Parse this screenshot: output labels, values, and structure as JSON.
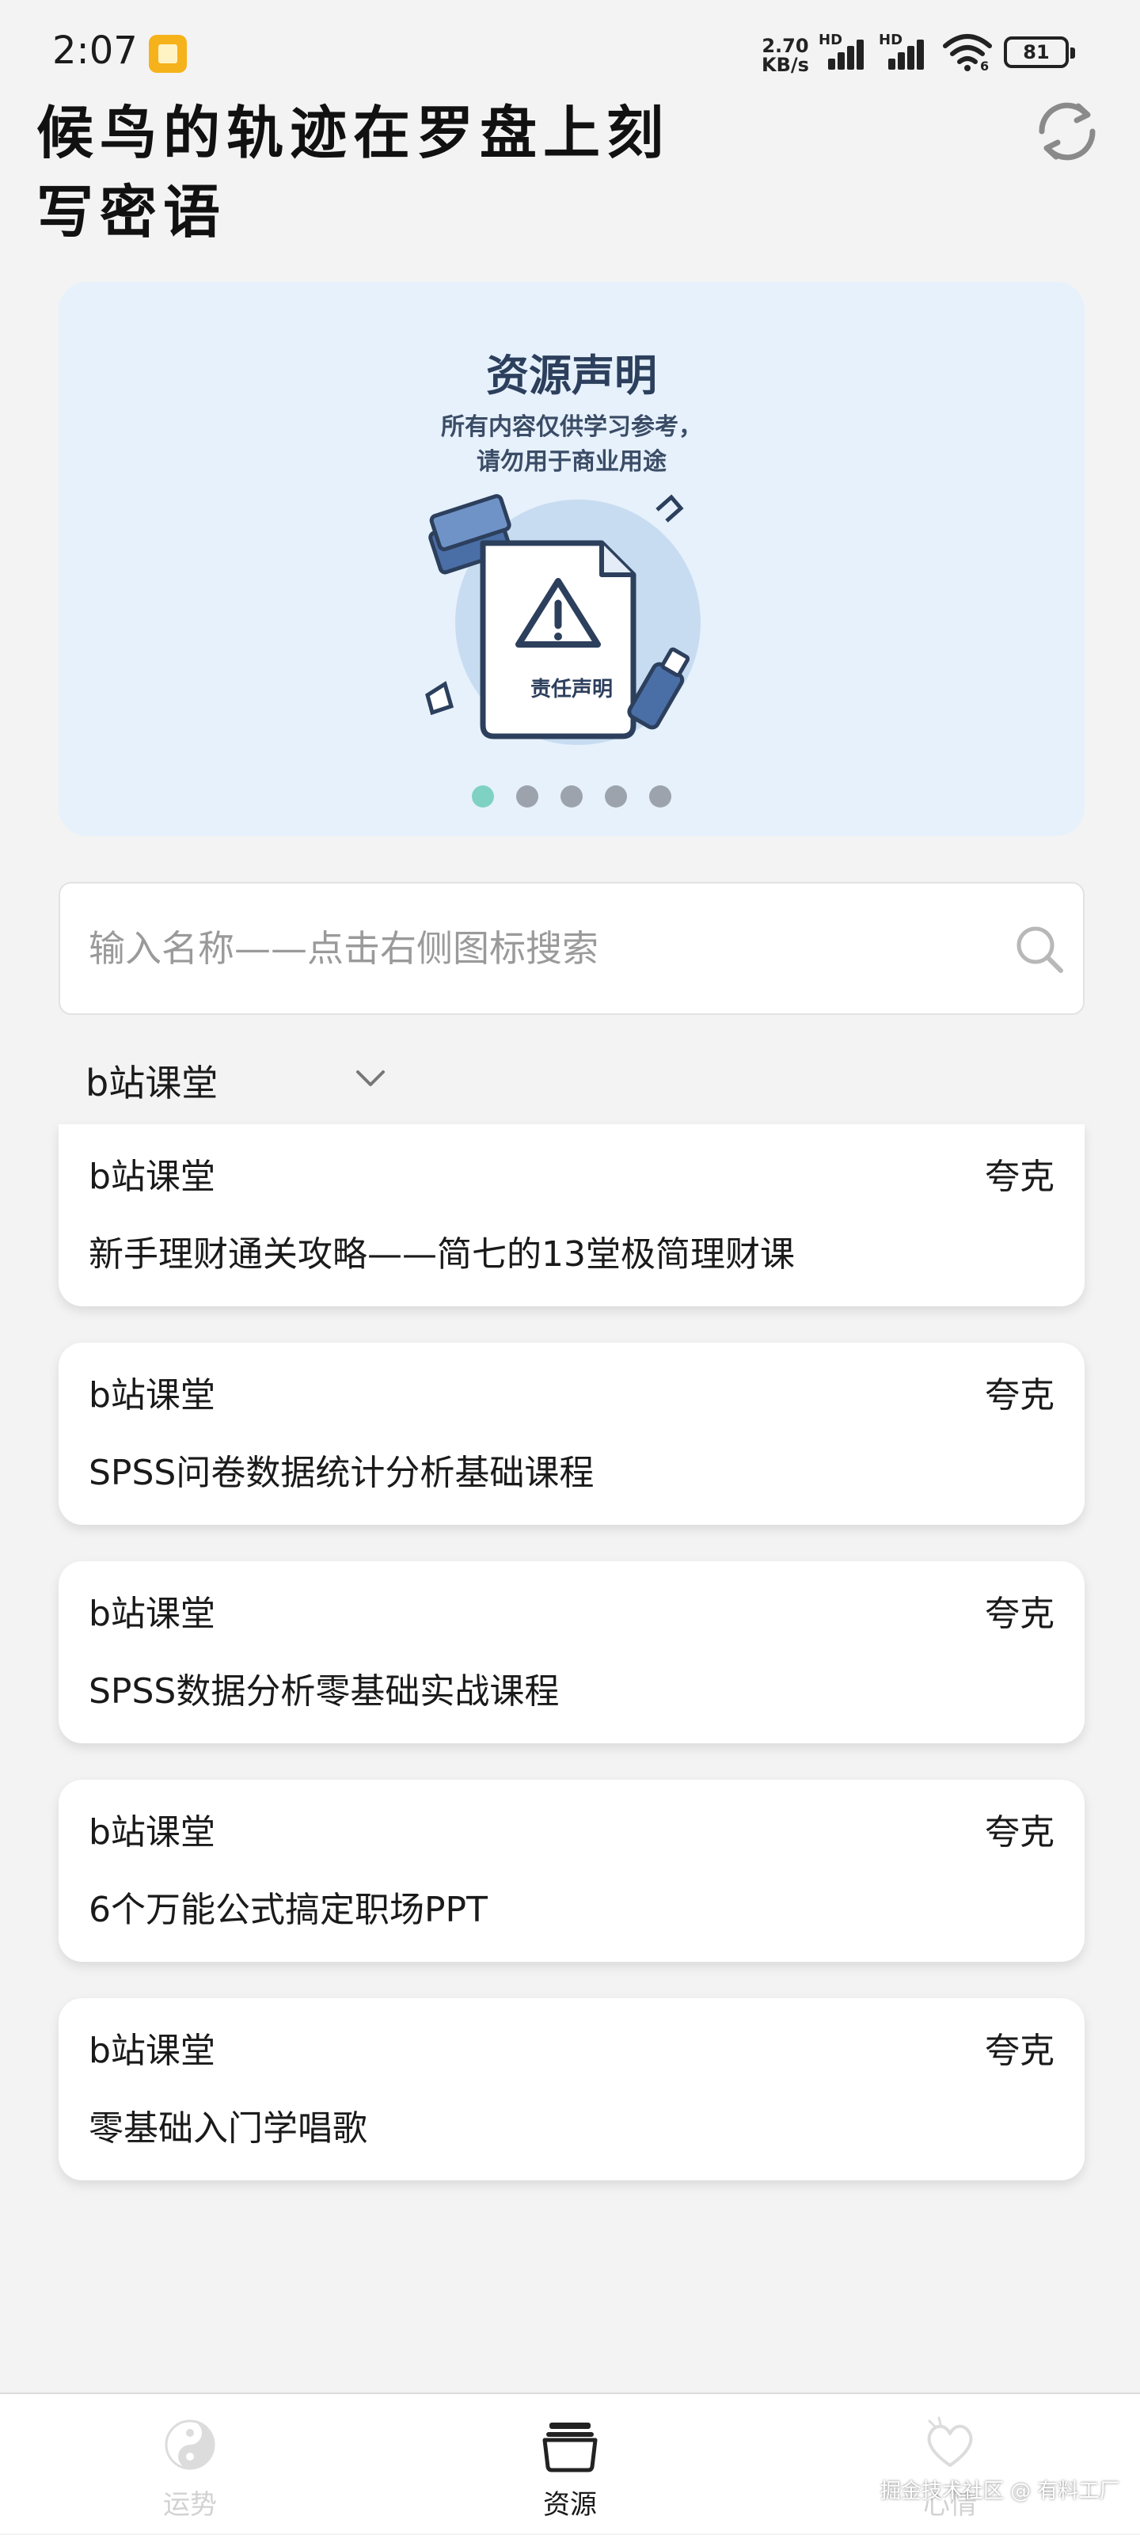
{
  "status_bar": {
    "time": "2:07",
    "network_speed_value": "2.70",
    "network_speed_unit": "KB/s",
    "sim1_label": "HD",
    "sim2_label": "HD",
    "wifi_badge": "6",
    "battery_level": "81"
  },
  "header": {
    "title": "候鸟的轨迹在罗盘上刻写密语",
    "refresh_icon": "refresh-icon"
  },
  "banner": {
    "title": "资源声明",
    "subtitle_line1": "所有内容仅供学习参考，",
    "subtitle_line2": "请勿用于商业用途",
    "document_label": "责任声明",
    "slide_count": 5,
    "active_slide": 1,
    "colors": {
      "active_dot": "#7fd2c3",
      "inactive_dot": "#9ca3ad",
      "background": "#e6f1fc"
    }
  },
  "search": {
    "placeholder": "输入名称——点击右侧图标搜索",
    "value": "",
    "icon": "search-icon"
  },
  "category": {
    "selected": "b站课堂",
    "icon": "chevron-down-icon"
  },
  "resources": [
    {
      "source": "b站课堂",
      "drive": "夸克",
      "title": "新手理财通关攻略——简七的13堂极简理财课"
    },
    {
      "source": "b站课堂",
      "drive": "夸克",
      "title": "SPSS问卷数据统计分析基础课程"
    },
    {
      "source": "b站课堂",
      "drive": "夸克",
      "title": "SPSS数据分析零基础实战课程"
    },
    {
      "source": "b站课堂",
      "drive": "夸克",
      "title": "6个万能公式搞定职场PPT"
    },
    {
      "source": "b站课堂",
      "drive": "夸克",
      "title": "零基础入门学唱歌"
    }
  ],
  "bottom_nav": {
    "items": [
      {
        "label": "运势",
        "icon": "yin-yang-icon",
        "active": false
      },
      {
        "label": "资源",
        "icon": "folder-icon",
        "active": true
      },
      {
        "label": "心情",
        "icon": "heart-icon",
        "active": false
      }
    ]
  },
  "watermark": "掘金技术社区 @ 有料工厂"
}
